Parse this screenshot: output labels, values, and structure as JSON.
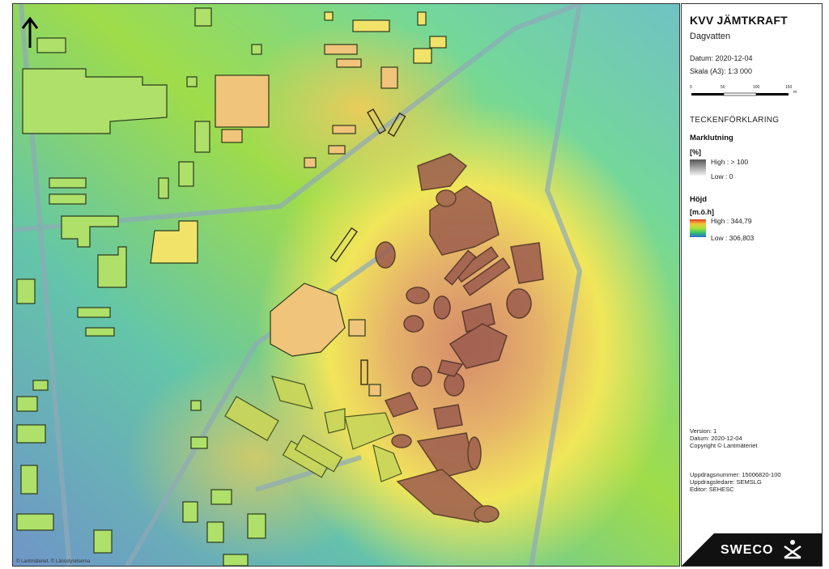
{
  "map": {
    "copyright": "© Lantmäteriet, © Länsstyrelserna",
    "icons": [
      "north-arrow-icon"
    ]
  },
  "legend": {
    "title": "KVV JÄMTKRAFT",
    "subtitle": "Dagvatten",
    "datum": "Datum: 2020-12-04",
    "skala": "Skala (A3): 1:3 000",
    "scalebar": {
      "ticks": [
        "0",
        "50",
        "100",
        "150"
      ],
      "unit": "m"
    },
    "heading": "TECKENFÖRKLARING",
    "marklutning": {
      "label": "Marklutning",
      "unit": "[%]",
      "high": "High : > 100",
      "low": "Low : 0"
    },
    "hojd": {
      "label": "Höjd",
      "unit": "[m.ö.h]",
      "high": "High : 344,79",
      "low": "Low : 306,803"
    },
    "version": "Version: 1",
    "datum2": "Datum: 2020-12-04",
    "copyright": "Copyright © Lantmäteriet",
    "uppdragsnummer": "Uppdragsnummer: 15006820-100",
    "uppdragsledare": "Uppdragsledare: SEMSLG",
    "editor": "Editor: SEHESC",
    "logo": "SWECO",
    "icons": [
      "sweco-logo-icon"
    ]
  },
  "colors": {
    "elev_low": "#6aa2c8",
    "elev_mid": "#b8de3c",
    "elev_high": "#c98062",
    "building_fill": "#aee06a",
    "frame": "#333333"
  }
}
